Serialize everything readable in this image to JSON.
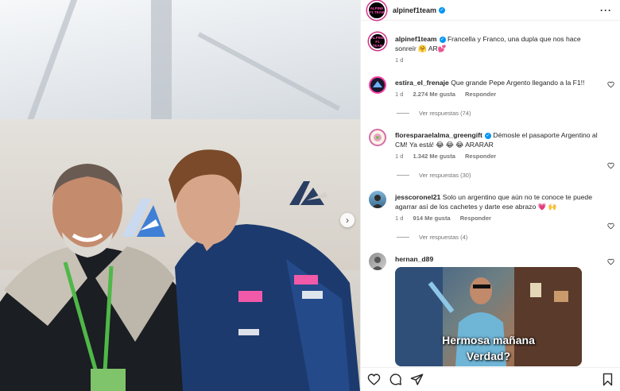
{
  "post": {
    "username": "alpinef1team",
    "avatar_text": "ALPINE F1 TEAM",
    "more_icon": "more-horizontal-icon",
    "caption_text": "Francella y Franco, una dupla que nos hace sonreír 🤗 AR💕",
    "caption_time": "1 d"
  },
  "comments": [
    {
      "user": "estira_el_frenaje",
      "text": "Que grande Pepe Argento llegando a la F1!!",
      "time": "1 d",
      "likes": "2.274 Me gusta",
      "reply": "Responder",
      "view_replies": "Ver respuestas (74)"
    },
    {
      "user": "floresparaelalma_greengift",
      "text": "Démosle el pasaporte Argentino al CM! Ya está! 😂 😂 😂 ARARAR",
      "time": "1 d",
      "likes": "1.342 Me gusta",
      "reply": "Responder",
      "view_replies": "Ver respuestas (30)"
    },
    {
      "user": "jesscoronel21",
      "text": "Solo un argentino que aún no te conoce te puede agarrar así de los cachetes y darte ese abrazo 💗 🙌",
      "time": "1 d",
      "likes": "914 Me gusta",
      "reply": "Responder",
      "view_replies": "Ver respuestas (4)"
    },
    {
      "user": "hernan_d89",
      "gif_line1": "Hermosa mañana",
      "gif_line2": "Verdad?"
    }
  ],
  "colors": {
    "verified": "#0095f6",
    "alpine_blue": "#1c3a6e",
    "brand_pink": "#ff4fb8"
  }
}
